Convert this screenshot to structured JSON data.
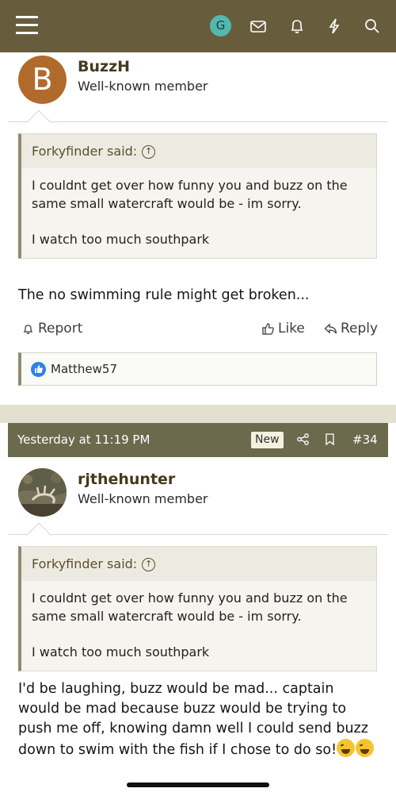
{
  "topbar": {
    "avatar_letter": "G",
    "icons": [
      "menu-icon",
      "mail-icon",
      "bell-icon",
      "lightning-icon",
      "search-icon"
    ]
  },
  "post1": {
    "avatar_letter": "B",
    "username": "BuzzH",
    "user_title": "Well-known member",
    "quote": {
      "author_said": "Forkyfinder said:",
      "lines": [
        "I couldnt get over how funny you and buzz on the same small watercraft would be - im sorry.",
        "I watch too much southpark"
      ]
    },
    "text": "The no swimming rule might get broken...",
    "actions": {
      "report": "Report",
      "like": "Like",
      "reply": "Reply"
    },
    "likes": "Matthew57"
  },
  "post2": {
    "date": "Yesterday at 11:19 PM",
    "badge": "New",
    "number": "#34",
    "username": "rjthehunter",
    "user_title": "Well-known member",
    "quote": {
      "author_said": "Forkyfinder said:",
      "lines": [
        "I couldnt get over how funny you and buzz on the same small watercraft would be - im sorry.",
        "I watch too much southpark"
      ]
    },
    "text": "I'd be laughing, buzz would be mad... captain would be mad because buzz would be trying to push me off, knowing damn well I could send buzz down to swim with the fish if I chose to do so!"
  }
}
